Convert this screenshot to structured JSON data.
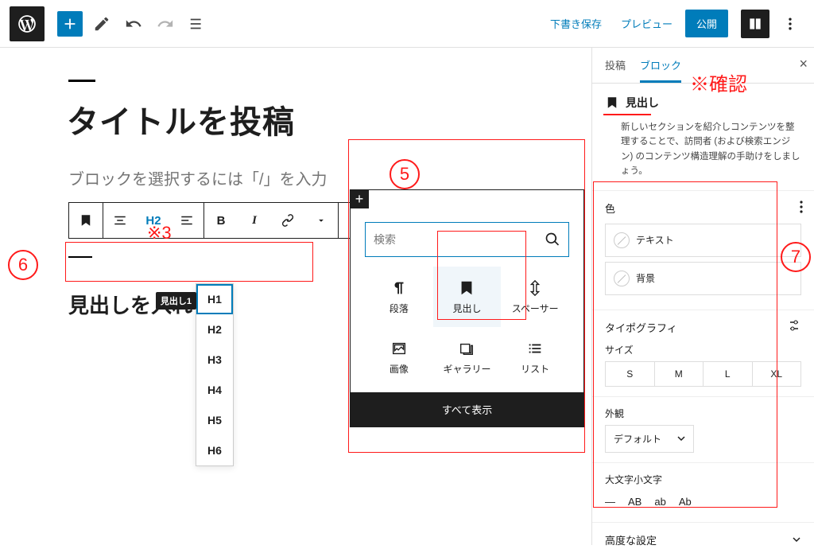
{
  "topbar": {
    "draft_save": "下書き保存",
    "preview": "プレビュー",
    "publish": "公開"
  },
  "editor": {
    "post_title": "タイトルを投稿",
    "placeholder": "ブロックを選択するには「/」を入力",
    "heading_text": "見出しを入れる",
    "toolbar": {
      "h2": "H2",
      "bold": "B",
      "italic": "I"
    }
  },
  "heading_dropdown": {
    "items": [
      "H1",
      "H2",
      "H3",
      "H4",
      "H5",
      "H6"
    ],
    "tooltip": "見出し1"
  },
  "inserter": {
    "search_placeholder": "検索",
    "blocks": [
      {
        "label": "段落"
      },
      {
        "label": "見出し"
      },
      {
        "label": "スペーサー"
      },
      {
        "label": "画像"
      },
      {
        "label": "ギャラリー"
      },
      {
        "label": "リスト"
      }
    ],
    "showall": "すべて表示"
  },
  "sidebar": {
    "tabs": {
      "post": "投稿",
      "block": "ブロック"
    },
    "block_name": "見出し",
    "block_desc": "新しいセクションを紹介しコンテンツを整理することで、訪問者 (および検索エンジン) のコンテンツ構造理解の手助けをしましょう。",
    "color": {
      "title": "色",
      "text": "テキスト",
      "bg": "背景"
    },
    "typography": {
      "title": "タイポグラフィ",
      "size_label": "サイズ",
      "sizes": [
        "S",
        "M",
        "L",
        "XL"
      ]
    },
    "appearance": {
      "title": "外観",
      "default": "デフォルト"
    },
    "lettercase": {
      "title": "大文字小文字",
      "options": [
        "—",
        "AB",
        "ab",
        "Ab"
      ]
    },
    "advanced": "高度な設定"
  },
  "annotations": {
    "confirm": "※確認",
    "star3": "※3",
    "n5": "5",
    "n6": "6",
    "n7": "7"
  }
}
